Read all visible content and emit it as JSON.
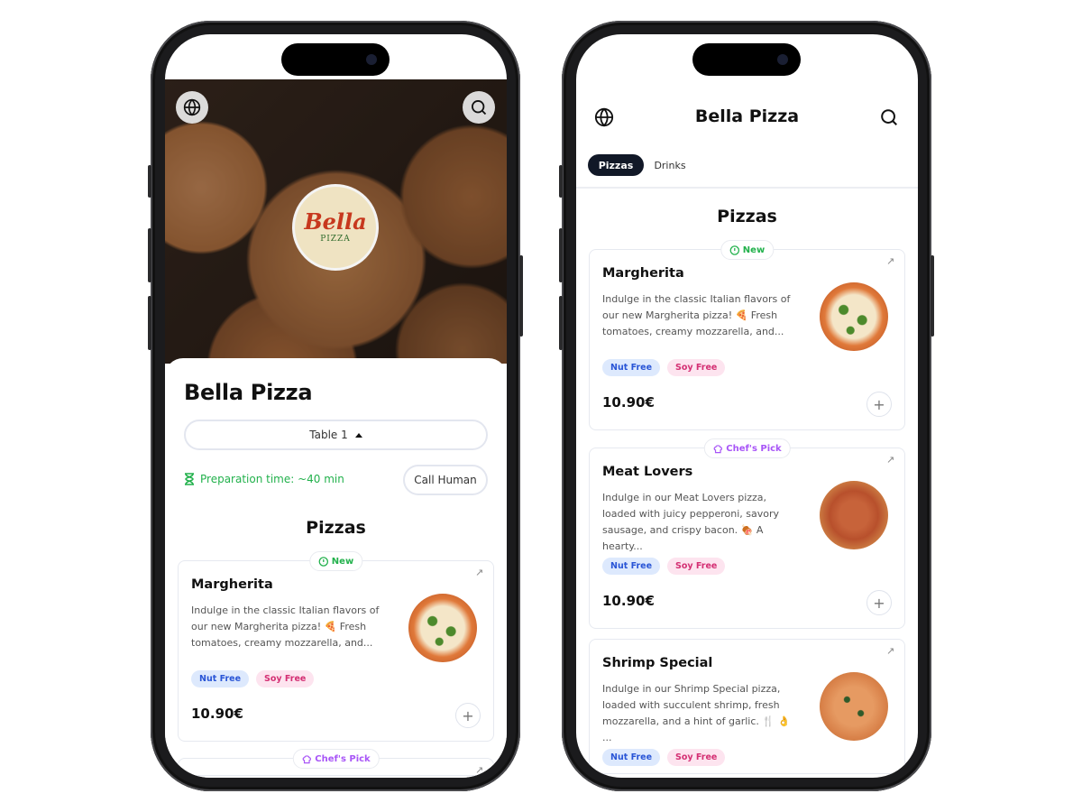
{
  "colors": {
    "accent_dark": "#111827",
    "new_green": "#22b14c",
    "chef_purple": "#a855f7",
    "nut_blue": "#2955d6",
    "soy_pink": "#d42f73"
  },
  "icons": {
    "language": "globe-icon",
    "search": "search-icon",
    "timer": "hourglass-icon",
    "new": "alert-circle-icon",
    "chef": "chef-hat-icon",
    "open": "arrow-up-right-icon",
    "add": "plus-icon"
  },
  "phone1": {
    "logo": {
      "script": "Bella",
      "word": "PIZZA"
    },
    "title": "Bella Pizza",
    "table_select": "Table 1",
    "prep_time": "Preparation time: ~40 min",
    "call_human": "Call Human",
    "section_title": "Pizzas",
    "items": [
      {
        "badge": "New",
        "badge_type": "new",
        "name": "Margherita",
        "desc": "Indulge in the classic Italian flavors of our new Margherita pizza! 🍕 Fresh tomatoes, creamy mozzarella, and...",
        "tags": [
          "Nut Free",
          "Soy Free"
        ],
        "price": "10.90€",
        "pizza": "margherita"
      },
      {
        "badge": "Chef's Pick",
        "badge_type": "chef",
        "name": "",
        "desc": "",
        "tags": [],
        "price": "",
        "pizza": ""
      }
    ]
  },
  "phone2": {
    "title": "Bella Pizza",
    "tabs": [
      {
        "label": "Pizzas",
        "active": true
      },
      {
        "label": "Drinks",
        "active": false
      }
    ],
    "section_title": "Pizzas",
    "items": [
      {
        "badge": "New",
        "badge_type": "new",
        "name": "Margherita",
        "desc": "Indulge in the classic Italian flavors of our new Margherita pizza! 🍕 Fresh tomatoes, creamy mozzarella, and...",
        "tags": [
          "Nut Free",
          "Soy Free"
        ],
        "price": "10.90€",
        "pizza": "margherita"
      },
      {
        "badge": "Chef's Pick",
        "badge_type": "chef",
        "name": "Meat Lovers",
        "desc": "Indulge in our Meat Lovers pizza, loaded with juicy pepperoni, savory sausage, and crispy bacon. 🍖 A hearty...",
        "tags": [
          "Nut Free",
          "Soy Free"
        ],
        "price": "10.90€",
        "pizza": "meat"
      },
      {
        "badge": "",
        "badge_type": "",
        "name": "Shrimp Special",
        "desc": "Indulge in our Shrimp Special pizza, loaded with succulent shrimp, fresh mozzarella, and a hint of garlic. 🍴 👌 ...",
        "tags": [
          "Nut Free",
          "Soy Free"
        ],
        "price": "",
        "pizza": "shrimp"
      }
    ]
  }
}
